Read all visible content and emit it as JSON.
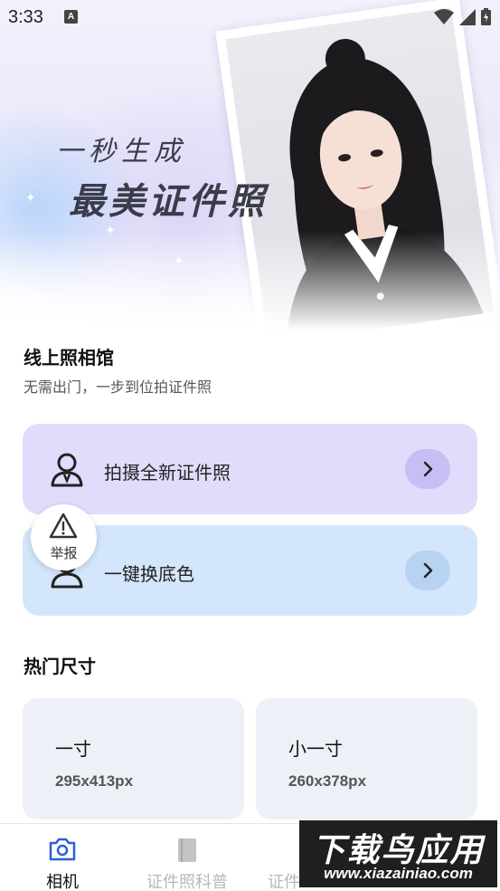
{
  "status_bar": {
    "time": "3:33",
    "notification_letter": "A"
  },
  "hero": {
    "line1": "一秒生成",
    "line2": "最美证件照"
  },
  "section": {
    "title": "线上照相馆",
    "subtitle": "无需出门，一步到位拍证件照"
  },
  "actions": [
    {
      "label": "拍摄全新证件照",
      "icon": "person-icon"
    },
    {
      "label": "一键换底色",
      "icon": "person-icon"
    }
  ],
  "report": {
    "label": "举报"
  },
  "hot": {
    "title": "热门尺寸",
    "sizes": [
      {
        "name": "一寸",
        "dimensions": "295x413px"
      },
      {
        "name": "小一寸",
        "dimensions": "260x378px"
      }
    ]
  },
  "nav": {
    "items": [
      {
        "label": "相机",
        "icon": "camera-icon",
        "active": true
      },
      {
        "label": "证件照科普",
        "icon": "book-icon",
        "active": false
      },
      {
        "label": "证件",
        "icon": "id-icon",
        "active": false
      }
    ]
  },
  "watermark": {
    "top": "下载鸟应用",
    "bottom": "www.xiazainiao.com"
  },
  "colors": {
    "accent": "#2d5fd8",
    "purple_card": "#e1dcfb",
    "blue_card": "#d4e6fb",
    "size_card": "#edf0f6"
  }
}
